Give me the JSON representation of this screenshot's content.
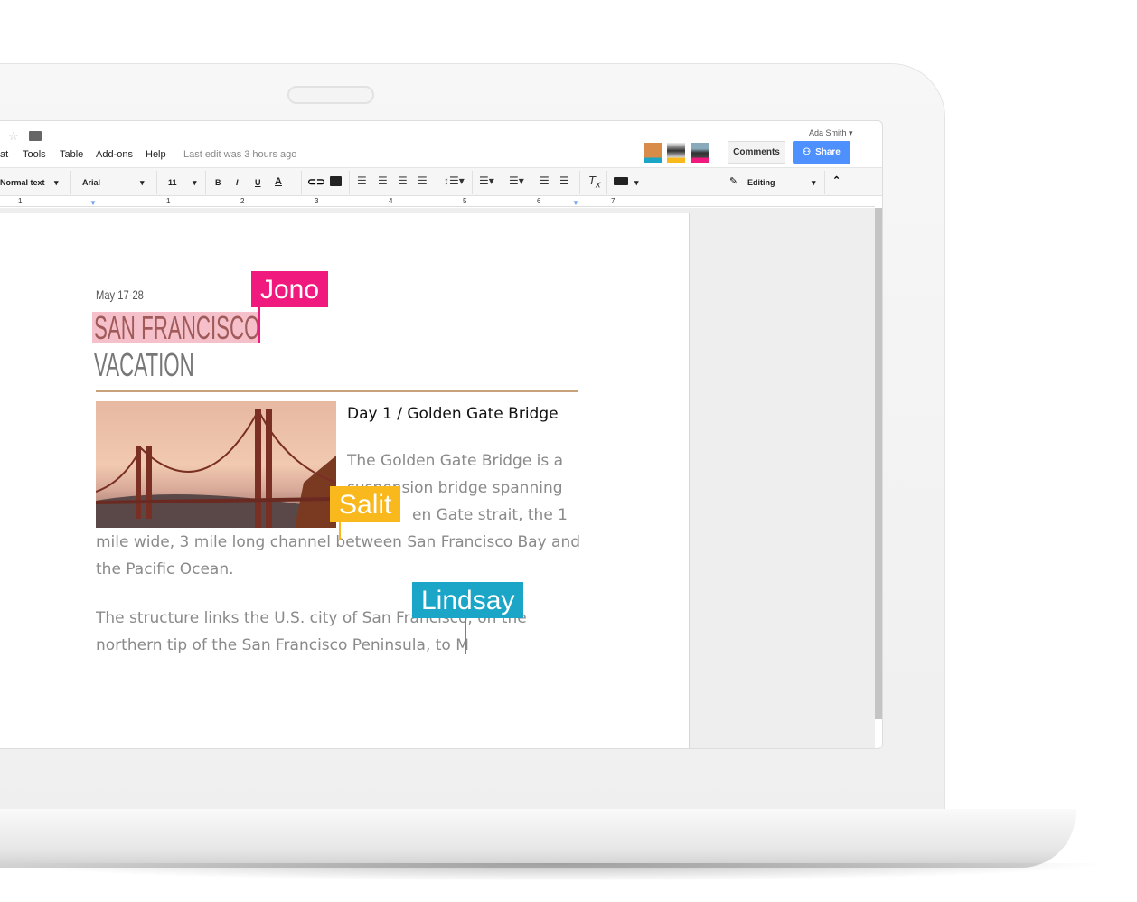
{
  "menu": {
    "items": [
      "at",
      "Tools",
      "Table",
      "Add-ons",
      "Help"
    ],
    "last_edit": "Last edit was 3 hours ago"
  },
  "account": {
    "user": "Ada Smith",
    "comments": "Comments",
    "share": "Share"
  },
  "toolbar": {
    "style": "Normal text",
    "font": "Arial",
    "size": "11",
    "bold": "B",
    "italic": "I",
    "underline": "U",
    "color": "A",
    "mode": "Editing"
  },
  "ruler": [
    "1",
    "1",
    "2",
    "3",
    "4",
    "5",
    "6",
    "7"
  ],
  "doc": {
    "date": "May 17-28",
    "title1": "SAN FRANCISCO",
    "title2": "VACATION",
    "heading": "Day 1 / Golden Gate Bridge",
    "p1": [
      "The Golden Gate Bridge is a",
      "suspension bridge spanning",
      "en Gate strait, the 1",
      "mile wide, 3 mile long channel between San Francisco Bay and",
      "the Pacific Ocean."
    ],
    "p2": [
      "The structure links the U.S. city of San Francisco, on the",
      "northern tip of the San Francisco Peninsula, to M"
    ]
  },
  "collaborators": [
    {
      "name": "Jono",
      "color": "#f0197d"
    },
    {
      "name": "Salit",
      "color": "#f9b81b"
    },
    {
      "name": "Lindsay",
      "color": "#1ba5c7"
    }
  ],
  "colors": {
    "share": "#4d90fe",
    "rule": "#c8a27a",
    "highlight": "#f5c0c9",
    "title": "#a05a5a"
  }
}
